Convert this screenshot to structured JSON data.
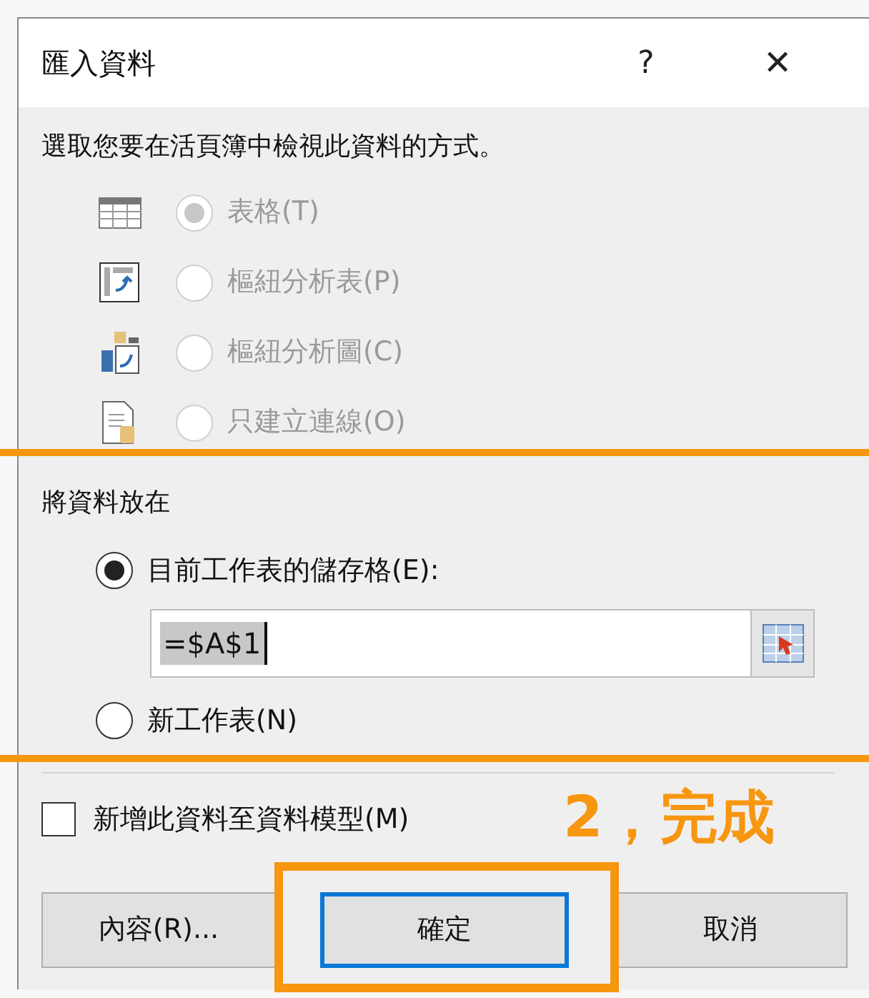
{
  "window": {
    "title": "匯入資料",
    "help": "?",
    "close": "✕"
  },
  "view_section": {
    "heading": "選取您要在活頁簿中檢視此資料的方式。",
    "options": [
      {
        "kind": "table",
        "label": "表格(T)",
        "selected": true,
        "disabled": true
      },
      {
        "kind": "pivot_table",
        "label": "樞紐分析表(P)",
        "selected": false,
        "disabled": true
      },
      {
        "kind": "pivot_chart",
        "label": "樞紐分析圖(C)",
        "selected": false,
        "disabled": true
      },
      {
        "kind": "connection",
        "label": "只建立連線(O)",
        "selected": false,
        "disabled": true
      }
    ]
  },
  "place_section": {
    "heading": "將資料放在",
    "options": [
      {
        "label": "目前工作表的儲存格(E):",
        "selected": true
      },
      {
        "label": "新工作表(N)",
        "selected": false
      }
    ],
    "cell_field": {
      "value": "=$A$1"
    }
  },
  "data_model": {
    "label": "新增此資料至資料模型(M)",
    "checked": false
  },
  "annotation": {
    "text": "2，完成"
  },
  "buttons": [
    {
      "label": "內容(R)...",
      "default": false
    },
    {
      "label": "確定",
      "default": true
    },
    {
      "label": "取消",
      "default": false
    }
  ]
}
